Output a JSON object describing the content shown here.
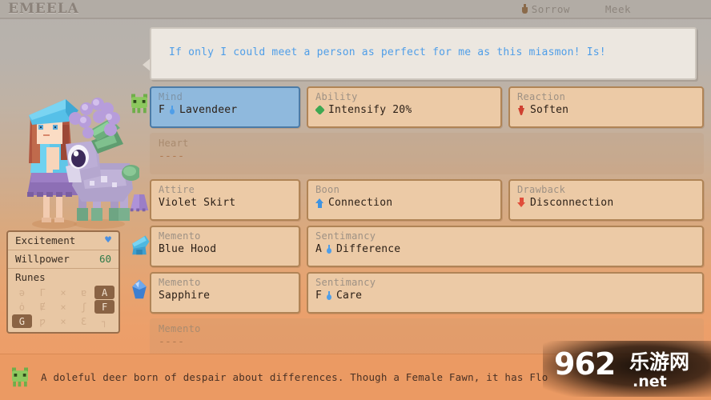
{
  "window": {
    "game_title": "EMEELA"
  },
  "topbar": {
    "mood": {
      "icon": "flask-icon",
      "label": "Sorrow"
    },
    "temperament": {
      "label": "Meek"
    }
  },
  "dialogue": {
    "text": "If only I could meet a person as perfect for me as this miasmon! Is!"
  },
  "stats": {
    "excitement": {
      "label": "Excitement",
      "icon": "heart-icon",
      "value": ""
    },
    "willpower": {
      "label": "Willpower",
      "value": "60",
      "color": "#2f7a4a"
    },
    "runes": {
      "label": "Runes",
      "cells": [
        {
          "glyph": "ǝ",
          "on": false
        },
        {
          "glyph": "Γ",
          "on": false
        },
        {
          "glyph": "×",
          "on": false
        },
        {
          "glyph": "ɐ",
          "on": false
        },
        {
          "glyph": "A",
          "on": true
        },
        {
          "glyph": "ȯ",
          "on": false
        },
        {
          "glyph": "Ɇ",
          "on": false
        },
        {
          "glyph": "×",
          "on": false
        },
        {
          "glyph": "ʃ",
          "on": false
        },
        {
          "glyph": "F",
          "on": true
        },
        {
          "glyph": "G",
          "on": true
        },
        {
          "glyph": "ƿ",
          "on": false
        },
        {
          "glyph": "×",
          "on": false
        },
        {
          "glyph": "Ɛ",
          "on": false
        },
        {
          "glyph": "┐",
          "on": false
        }
      ]
    }
  },
  "slots": {
    "rows": [
      {
        "rail_icon": "green-miasmon-icon",
        "cells": [
          {
            "label": "Mind",
            "grade": "F",
            "icon": "water-drop-icon",
            "value": "Lavendeer",
            "state": "selected",
            "width": "w-left"
          },
          {
            "label": "Ability",
            "grade": "",
            "icon": "green-gem-icon",
            "value": "Intensify 20%",
            "state": "normal",
            "width": "w-mid"
          },
          {
            "label": "Reaction",
            "grade": "",
            "icon": "red-flask-icon",
            "value": "Soften",
            "state": "normal",
            "width": "w-right"
          }
        ]
      },
      {
        "rail_icon": "",
        "cells": [
          {
            "label": "Heart",
            "grade": "",
            "icon": "",
            "value": "----",
            "state": "empty",
            "width": "w-wide"
          }
        ]
      },
      {
        "rail_icon": "violet-skirt-icon",
        "cells": [
          {
            "label": "Attire",
            "grade": "",
            "icon": "",
            "value": "Violet Skirt",
            "state": "normal",
            "width": "w-left"
          },
          {
            "label": "Boon",
            "grade": "",
            "icon": "up-arrow-icon",
            "value": "Connection",
            "state": "normal",
            "width": "w-mid"
          },
          {
            "label": "Drawback",
            "grade": "",
            "icon": "down-arrow-icon",
            "value": "Disconnection",
            "state": "normal",
            "width": "w-right"
          }
        ]
      },
      {
        "rail_icon": "blue-hood-icon",
        "cells": [
          {
            "label": "Memento",
            "grade": "",
            "icon": "",
            "value": "Blue Hood",
            "state": "normal",
            "width": "w-left"
          },
          {
            "label": "Sentimancy",
            "grade": "A",
            "icon": "water-drop-icon",
            "value": "Difference",
            "state": "normal",
            "width": "w-wide"
          }
        ]
      },
      {
        "rail_icon": "sapphire-gem-icon",
        "cells": [
          {
            "label": "Memento",
            "grade": "",
            "icon": "",
            "value": "Sapphire",
            "state": "normal",
            "width": "w-left"
          },
          {
            "label": "Sentimancy",
            "grade": "F",
            "icon": "water-drop-icon",
            "value": "Care",
            "state": "normal",
            "width": "w-wide"
          }
        ]
      },
      {
        "rail_icon": "",
        "cells": [
          {
            "label": "Memento",
            "grade": "",
            "icon": "",
            "value": "----",
            "state": "empty",
            "width": "w-wide"
          }
        ]
      }
    ]
  },
  "description": {
    "icon": "green-miasmon-icon",
    "text": "A doleful deer born of despair about differences. Though a Female Fawn, it has Flo"
  },
  "watermark": {
    "number": "962",
    "cn": "乐游网",
    "tld": ".net"
  },
  "colors": {
    "accent_blue": "#4f9ee8",
    "selected_slot": "#8fb9dd",
    "slot_bg": "#eccaa6",
    "slot_border": "#b08456",
    "panel_bg": "#e8c7a4",
    "panel_border": "#9a6f4c",
    "bottom_bar": "#eb9a63",
    "topbar": "#b2aca5",
    "willpower_green": "#2f7a4a",
    "ability_green": "#3fa852",
    "reaction_red": "#cf4030",
    "drawback_red": "#e04d3a"
  }
}
